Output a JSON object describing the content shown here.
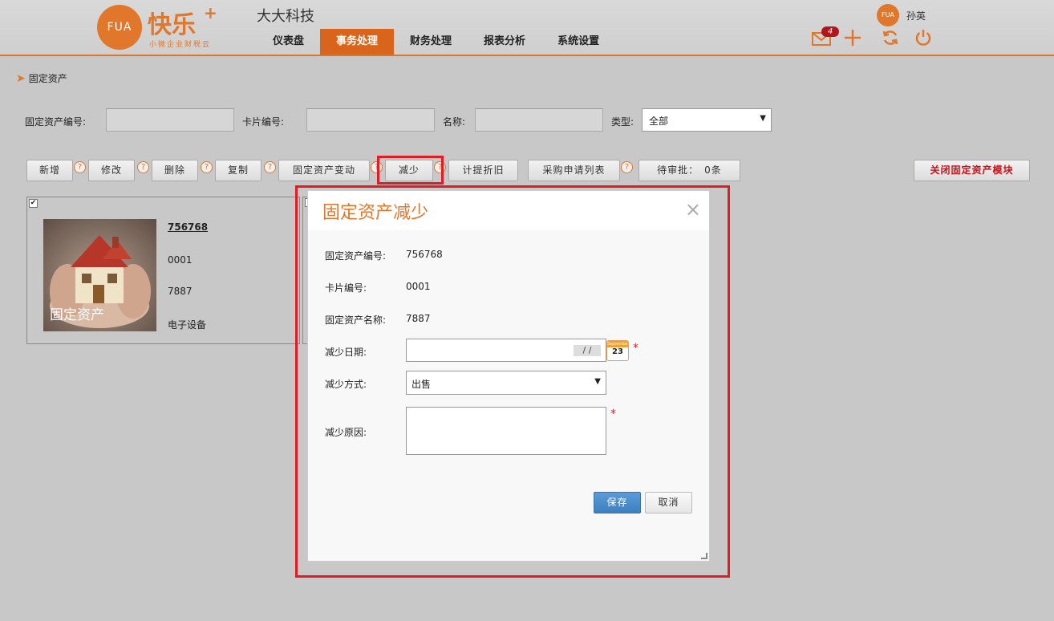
{
  "header": {
    "logo_circle_text": "FUA",
    "logo_text": "快乐",
    "logo_plus": "+",
    "logo_sub": "小微企业财税云",
    "company": "大大科技",
    "nav": [
      "仪表盘",
      "事务处理",
      "财务处理",
      "报表分析",
      "系统设置"
    ],
    "nav_active_index": 1,
    "user_avatar_text": "FUA",
    "user_name": "孙英",
    "mail_count": "4",
    "icons": [
      "mail-icon",
      "plus-icon",
      "refresh-icon",
      "power-icon"
    ]
  },
  "breadcrumb": {
    "current": "固定资产"
  },
  "search": {
    "asset_no_label": "固定资产编号:",
    "card_no_label": "卡片编号:",
    "name_label": "名称:",
    "type_label": "类型:",
    "type_value": "全部"
  },
  "toolbar": {
    "add": "新增",
    "edit": "修改",
    "delete": "删除",
    "copy": "复制",
    "change": "固定资产变动",
    "reduce": "减少",
    "depreciation": "计提折旧",
    "purchase_list": "采购申请列表",
    "pending": "待审批：　0条",
    "close_module": "关闭固定资产模块",
    "help_glyph": "?"
  },
  "card": {
    "image_label": "固定资产",
    "code": "756768",
    "card_no": "0001",
    "name": "7887",
    "type": "电子设备"
  },
  "modal": {
    "title": "固定资产减少",
    "close": "×",
    "asset_no_label": "固定资产编号:",
    "asset_no": "756768",
    "card_no_label": "卡片编号:",
    "card_no": "0001",
    "asset_name_label": "固定资产名称:",
    "asset_name": "7887",
    "date_label": "减少日期:",
    "date_mask": "/ /",
    "calendar_month": "September",
    "calendar_day": "23",
    "method_label": "减少方式:",
    "method_value": "出售",
    "reason_label": "减少原因:",
    "required_mark": "*",
    "save": "保存",
    "cancel": "取消"
  },
  "colors": {
    "accent": "#e0772a",
    "nav_active": "#d9651c",
    "highlight": "#e01c24",
    "save": "#3d7fc0"
  }
}
